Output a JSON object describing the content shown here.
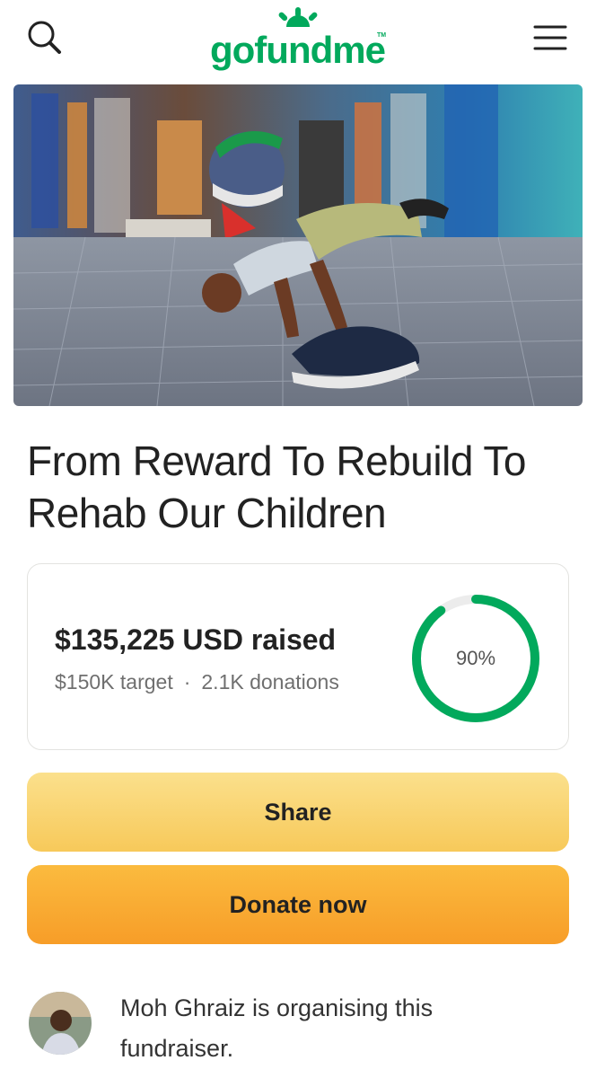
{
  "header": {
    "logo_text": "gofundme",
    "logo_tm": "TM",
    "search_icon": "search-icon",
    "menu_icon": "hamburger-menu-icon",
    "brand_color": "#02a95c"
  },
  "campaign": {
    "title": "From Reward To Rebuild To Rehab Our Children"
  },
  "progress": {
    "raised": "$135,225 USD raised",
    "target": "$150K target",
    "separator": "·",
    "donations": "2.1K donations",
    "percent_label": "90%",
    "percent": 0.9,
    "ring_color": "#02a95c",
    "ring_track_color": "#ececec"
  },
  "actions": {
    "share_label": "Share",
    "donate_label": "Donate now"
  },
  "organiser": {
    "text": "Moh Ghraiz is organising this fundraiser."
  }
}
